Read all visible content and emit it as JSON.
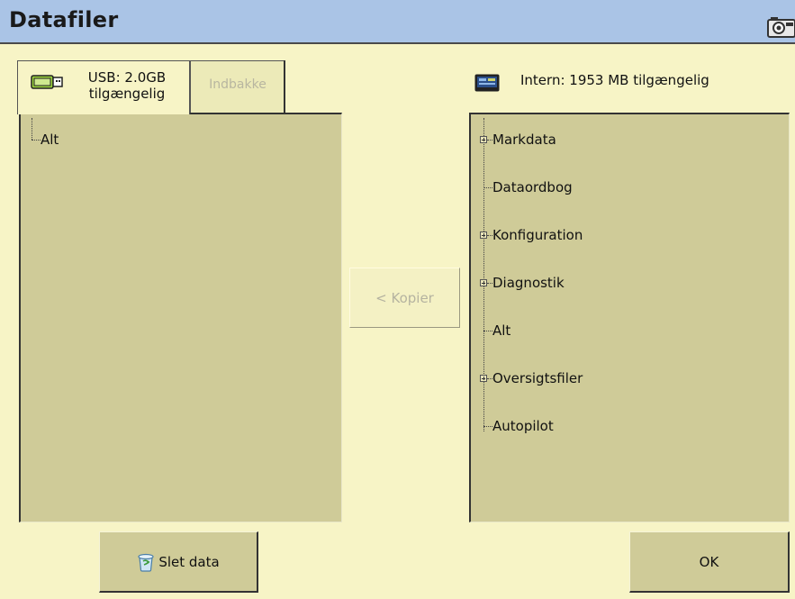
{
  "window": {
    "title": "Datafiler"
  },
  "tabs": [
    {
      "label_line1": "USB: 2.0GB",
      "label_line2": "tilgængelig",
      "icon": "usb-drive-icon",
      "active": true
    },
    {
      "label": "Indbakke",
      "active": false,
      "disabled": true
    }
  ],
  "left_tree": {
    "items": [
      {
        "label": "Alt",
        "expandable": false
      }
    ]
  },
  "internal": {
    "label": "Intern: 1953 MB tilgængelig",
    "icon": "internal-storage-icon"
  },
  "right_tree": {
    "items": [
      {
        "label": "Markdata",
        "expandable": true
      },
      {
        "label": "Dataordbog",
        "expandable": false
      },
      {
        "label": "Konfiguration",
        "expandable": true
      },
      {
        "label": "Diagnostik",
        "expandable": true
      },
      {
        "label": "Alt",
        "expandable": false
      },
      {
        "label": "Oversigtsfiler",
        "expandable": true
      },
      {
        "label": "Autopilot",
        "expandable": false
      }
    ]
  },
  "buttons": {
    "copy_label": "< Kopier",
    "delete_label": "Slet data",
    "ok_label": "OK"
  },
  "colors": {
    "background": "#f7f4c6",
    "titlebar": "#aac4e6",
    "panel": "#cfcb98",
    "disabled_text": "#b5b3a0"
  }
}
